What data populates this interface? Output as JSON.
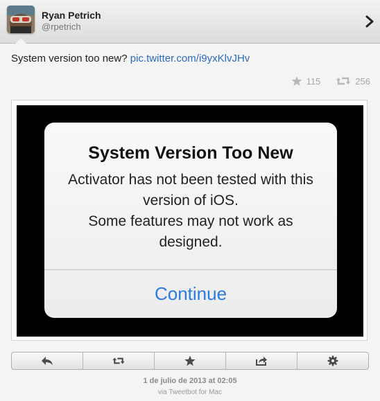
{
  "header": {
    "name": "Ryan Petrich",
    "handle": "@rpetrich"
  },
  "tweet": {
    "text": "System version too new?",
    "link": "pic.twitter.com/i9yxKlvJHv",
    "favorites": "115",
    "retweets": "256"
  },
  "media": {
    "alert_title": "System Version Too New",
    "alert_lines": [
      "Activator has not been tested with this",
      "version of iOS.",
      "Some features may not work as",
      "designed."
    ],
    "alert_button": "Continue"
  },
  "toolbar": {
    "icons": [
      "reply-icon",
      "retweet-icon",
      "star-icon",
      "share-icon",
      "gear-icon"
    ]
  },
  "footer": {
    "date": "1 de julio de 2013 at 02:05",
    "via": "via Tweetbot for Mac"
  },
  "colors": {
    "link": "#2b6bbf",
    "alert_button": "#2a7ce2"
  }
}
